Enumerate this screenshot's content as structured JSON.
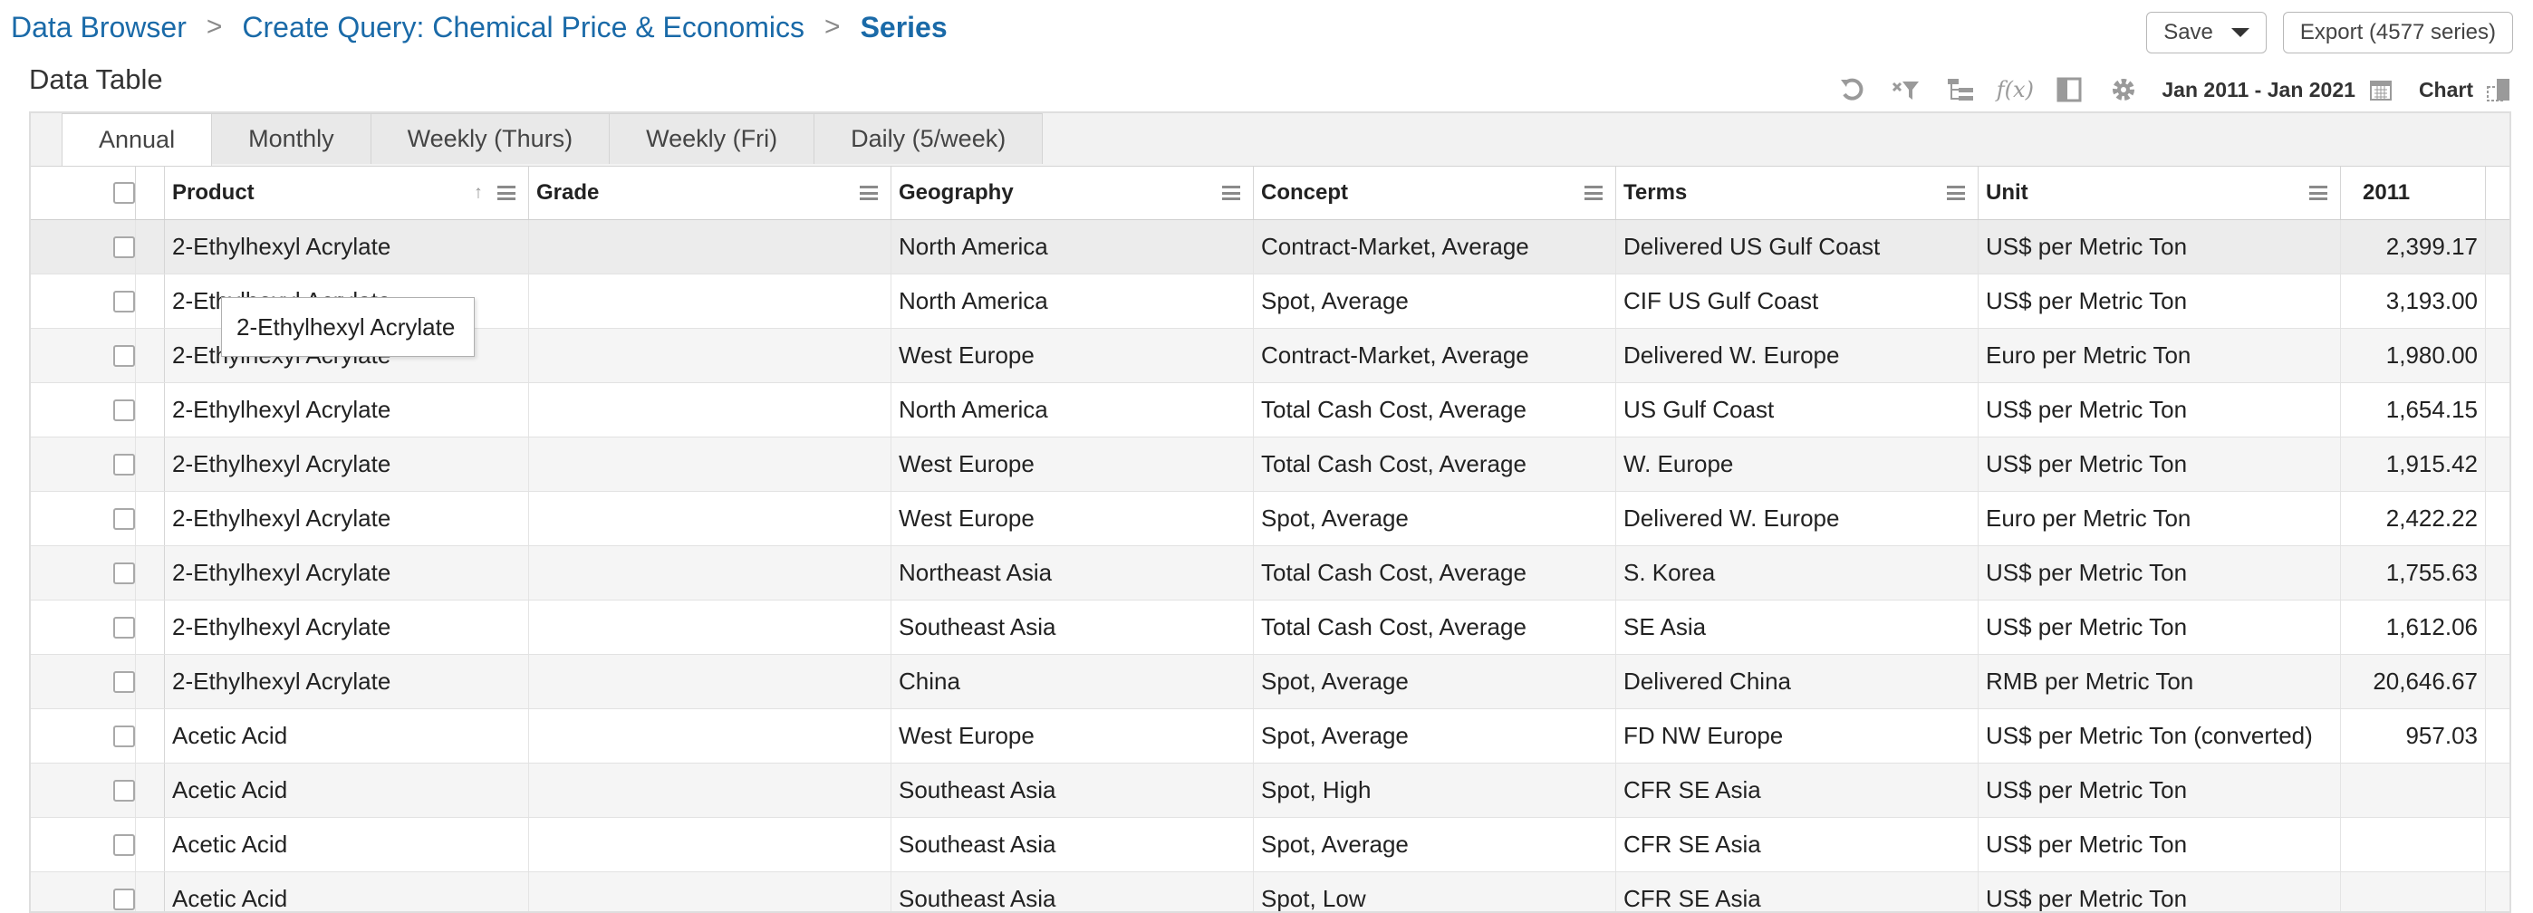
{
  "breadcrumb": {
    "items": [
      "Data Browser",
      "Create Query: Chemical Price & Economics"
    ],
    "current": "Series",
    "separator": ">"
  },
  "buttons": {
    "save": "Save",
    "export": "Export (4577 series)"
  },
  "page_title": "Data Table",
  "toolbar": {
    "date_range": "Jan 2011 - Jan 2021",
    "chart_label": "Chart",
    "icons": [
      "undo-icon",
      "clear-filter-icon",
      "hierarchy-icon",
      "function-icon",
      "columns-icon",
      "gear-icon",
      "calendar-icon",
      "chart-toggle-icon"
    ],
    "function_glyph": "f(x)"
  },
  "tabs": [
    {
      "label": "Annual",
      "active": true
    },
    {
      "label": "Monthly",
      "active": false
    },
    {
      "label": "Weekly (Thurs)",
      "active": false
    },
    {
      "label": "Weekly (Fri)",
      "active": false
    },
    {
      "label": "Daily (5/week)",
      "active": false
    }
  ],
  "columns": {
    "product": "Product",
    "grade": "Grade",
    "geography": "Geography",
    "concept": "Concept",
    "terms": "Terms",
    "unit": "Unit",
    "year": "2011"
  },
  "rows": [
    {
      "product": "2-Ethylhexyl Acrylate",
      "grade": "",
      "geography": "North America",
      "concept": "Contract-Market, Average",
      "terms": "Delivered US Gulf Coast",
      "unit": "US$ per Metric Ton",
      "value": "2,399.17"
    },
    {
      "product": "2-Ethylhexyl Acrylate",
      "grade": "",
      "geography": "North America",
      "concept": "Spot, Average",
      "terms": "CIF US Gulf Coast",
      "unit": "US$ per Metric Ton",
      "value": "3,193.00"
    },
    {
      "product": "2-Ethylhexyl Acrylate",
      "grade": "",
      "geography": "West Europe",
      "concept": "Contract-Market, Average",
      "terms": "Delivered W. Europe",
      "unit": "Euro per Metric Ton",
      "value": "1,980.00"
    },
    {
      "product": "2-Ethylhexyl Acrylate",
      "grade": "",
      "geography": "North America",
      "concept": "Total Cash Cost, Average",
      "terms": "US Gulf Coast",
      "unit": "US$ per Metric Ton",
      "value": "1,654.15"
    },
    {
      "product": "2-Ethylhexyl Acrylate",
      "grade": "",
      "geography": "West Europe",
      "concept": "Total Cash Cost, Average",
      "terms": "W. Europe",
      "unit": "US$ per Metric Ton",
      "value": "1,915.42"
    },
    {
      "product": "2-Ethylhexyl Acrylate",
      "grade": "",
      "geography": "West Europe",
      "concept": "Spot, Average",
      "terms": "Delivered W. Europe",
      "unit": "Euro per Metric Ton",
      "value": "2,422.22"
    },
    {
      "product": "2-Ethylhexyl Acrylate",
      "grade": "",
      "geography": "Northeast Asia",
      "concept": "Total Cash Cost, Average",
      "terms": "S. Korea",
      "unit": "US$ per Metric Ton",
      "value": "1,755.63"
    },
    {
      "product": "2-Ethylhexyl Acrylate",
      "grade": "",
      "geography": "Southeast Asia",
      "concept": "Total Cash Cost, Average",
      "terms": "SE Asia",
      "unit": "US$ per Metric Ton",
      "value": "1,612.06"
    },
    {
      "product": "2-Ethylhexyl Acrylate",
      "grade": "",
      "geography": "China",
      "concept": "Spot, Average",
      "terms": "Delivered China",
      "unit": "RMB per Metric Ton",
      "value": "20,646.67"
    },
    {
      "product": "Acetic Acid",
      "grade": "",
      "geography": "West Europe",
      "concept": "Spot, Average",
      "terms": "FD NW Europe",
      "unit": "US$ per Metric Ton (converted)",
      "value": "957.03"
    },
    {
      "product": "Acetic Acid",
      "grade": "",
      "geography": "Southeast Asia",
      "concept": "Spot, High",
      "terms": "CFR SE Asia",
      "unit": "US$ per Metric Ton",
      "value": ""
    },
    {
      "product": "Acetic Acid",
      "grade": "",
      "geography": "Southeast Asia",
      "concept": "Spot, Average",
      "terms": "CFR SE Asia",
      "unit": "US$ per Metric Ton",
      "value": ""
    },
    {
      "product": "Acetic Acid",
      "grade": "",
      "geography": "Southeast Asia",
      "concept": "Spot, Low",
      "terms": "CFR SE Asia",
      "unit": "US$ per Metric Ton",
      "value": ""
    }
  ],
  "tooltip": "2-Ethylhexyl Acrylate"
}
